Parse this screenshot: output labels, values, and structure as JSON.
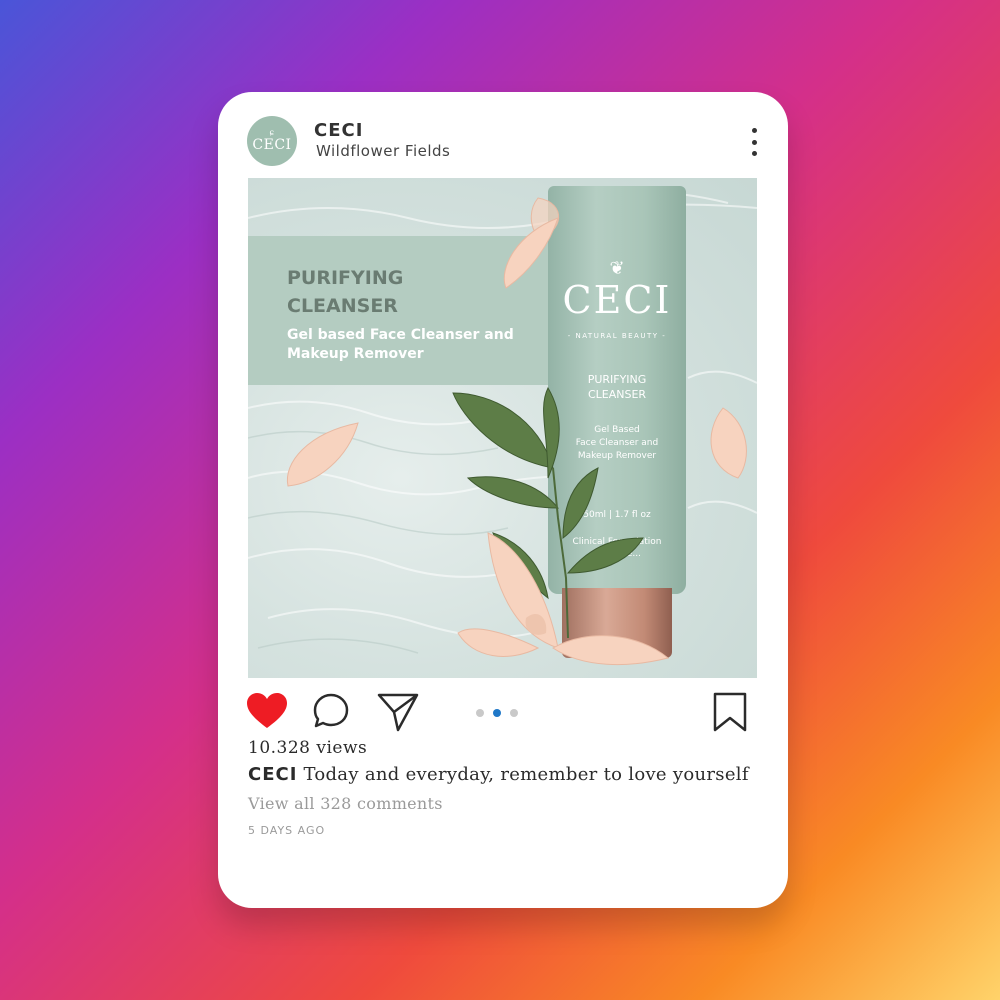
{
  "post": {
    "username": "CECI",
    "location": "Wildflower Fields",
    "avatar_text": "CECI",
    "image": {
      "banner_title": "PURIFYING\nCLEANSER",
      "banner_subtitle": "Gel based Face Cleanser and\nMakeup Remover",
      "product_brand": "CECI",
      "product_tagline": "- NATURAL BEAUTY -",
      "product_name": "PURIFYING\nCLEANSER",
      "product_description": "Gel Based\nFace Cleanser and\nMakeup Remover",
      "product_volume": "50ml | 1.7 fl oz",
      "product_clinical": "Clinical Formulation\nwith Inte..."
    },
    "carousel": {
      "count": 3,
      "active_index": 1
    },
    "views": "10.328 views",
    "caption_user": "CECI",
    "caption_text": " Today and everyday, remember to love yourself",
    "comments_link": "View all 328 comments",
    "timestamp": "5 DAYS AGO",
    "liked": true
  },
  "colors": {
    "heart": "#ee1c24",
    "dot_active": "#1f78c8",
    "dot_inactive": "#c9c9c9",
    "brand_sage": "#9fbeaf"
  },
  "icons": [
    "more-vertical-icon",
    "heart-icon",
    "comment-icon",
    "share-icon",
    "bookmark-icon"
  ]
}
